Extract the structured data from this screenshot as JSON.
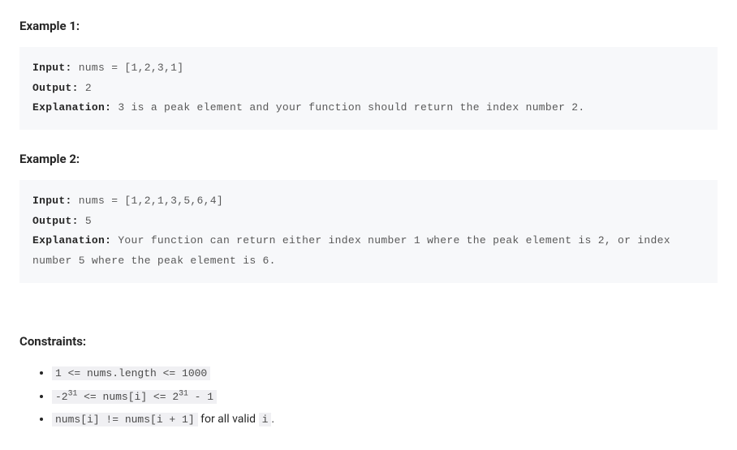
{
  "example1": {
    "heading": "Example 1:",
    "input_label": "Input:",
    "input_value": " nums = [1,2,3,1]",
    "output_label": "Output:",
    "output_value": " 2",
    "explanation_label": "Explanation:",
    "explanation_value": " 3 is a peak element and your function should return the index number 2."
  },
  "example2": {
    "heading": "Example 2:",
    "input_label": "Input:",
    "input_value": " nums = [1,2,1,3,5,6,4]",
    "output_label": "Output:",
    "output_value": " 5",
    "explanation_label": "Explanation:",
    "explanation_value": " Your function can return either index number 1 where the peak element is 2, or index number 5 where the peak element is 6."
  },
  "constraints": {
    "heading": "Constraints:",
    "item1": "1 <= nums.length <= 1000",
    "item2_pre": "-2",
    "item2_sup1": "31",
    "item2_mid": " <= nums[i] <= 2",
    "item2_sup2": "31",
    "item2_post": " - 1",
    "item3_code1": "nums[i] != nums[i + 1]",
    "item3_text": " for all valid ",
    "item3_code2": "i",
    "item3_period": "."
  }
}
